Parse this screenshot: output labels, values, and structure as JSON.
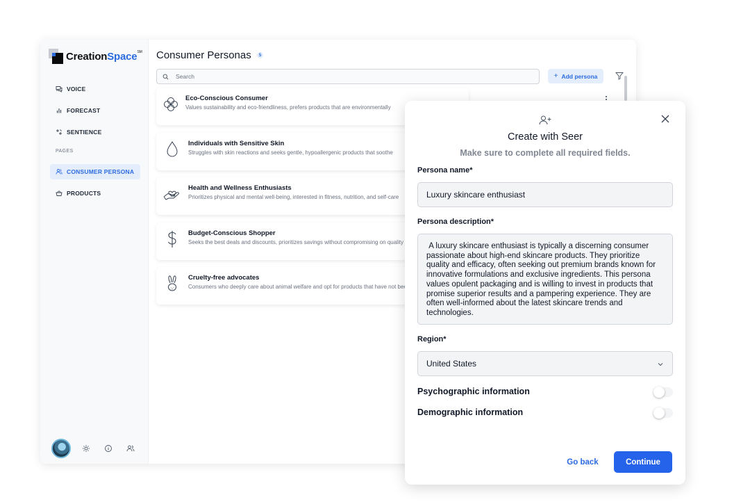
{
  "app": {
    "logo": {
      "brand_main": "Creation",
      "brand_accent": "Space",
      "brand_mark": "SM"
    },
    "sidebar": {
      "items": [
        {
          "label": "VOICE",
          "icon": "chat-icon"
        },
        {
          "label": "FORECAST",
          "icon": "bar-chart-icon"
        },
        {
          "label": "SENTIENCE",
          "icon": "sparkle-icon"
        }
      ],
      "section_label": "PAGES",
      "pages": [
        {
          "label": "CONSUMER PERSONA",
          "icon": "users-icon",
          "active": true
        },
        {
          "label": "PRODUCTS",
          "icon": "basket-icon",
          "active": false
        }
      ],
      "footer_icons": [
        "avatar",
        "sun-icon",
        "info-icon",
        "users-icon"
      ]
    }
  },
  "main": {
    "title": "Consumer Personas",
    "count": "5",
    "search_placeholder": "Search",
    "add_button": "Add persona",
    "personas": [
      {
        "name": "Eco-Conscious Consumer",
        "description": "Values sustainability and eco-friendliness, prefers products that are environmentally",
        "icon": "flower-icon"
      },
      {
        "name": "Individuals with Sensitive Skin",
        "description": "Struggles with skin reactions and seeks gentle, hypoallergenic products that soothe",
        "icon": "droplet-icon"
      },
      {
        "name": "Health and Wellness Enthusiasts",
        "description": "Prioritizes physical and mental well-being, interested in fitness, nutrition, and self-care",
        "icon": "heart-hand-icon"
      },
      {
        "name": "Budget-Conscious Shopper",
        "description": "Seeks the best deals and discounts, prioritizes savings without compromising on quality",
        "icon": "dollar-icon"
      },
      {
        "name": "Cruelty-free advocates",
        "description": "Consumers who deeply care about animal welfare and opt for products that have not been",
        "icon": "bunny-icon"
      }
    ]
  },
  "modal": {
    "title": "Create with Seer",
    "subtitle": "Make sure to complete all required fields.",
    "persona_name_label": "Persona name*",
    "persona_name_value": "Luxury skincare enthusiast",
    "persona_description_label": "Persona description*",
    "persona_description_value": " A luxury skincare enthusiast is typically a discerning consumer passionate about high-end skincare products. They prioritize quality and efficacy, often seeking out premium brands known for innovative formulations and exclusive ingredients. This persona values opulent packaging and is willing to invest in products that promise superior results and a pampering experience. They are often well-informed about the latest skincare trends and technologies.",
    "region_label": "Region*",
    "region_value": "United States",
    "psychographic_label": "Psychographic information",
    "demographic_label": "Demographic information",
    "psychographic_enabled": false,
    "demographic_enabled": false,
    "go_back_label": "Go back",
    "continue_label": "Continue",
    "colors": {
      "primary": "#2563eb",
      "accent_bg": "#e4edfb"
    }
  }
}
